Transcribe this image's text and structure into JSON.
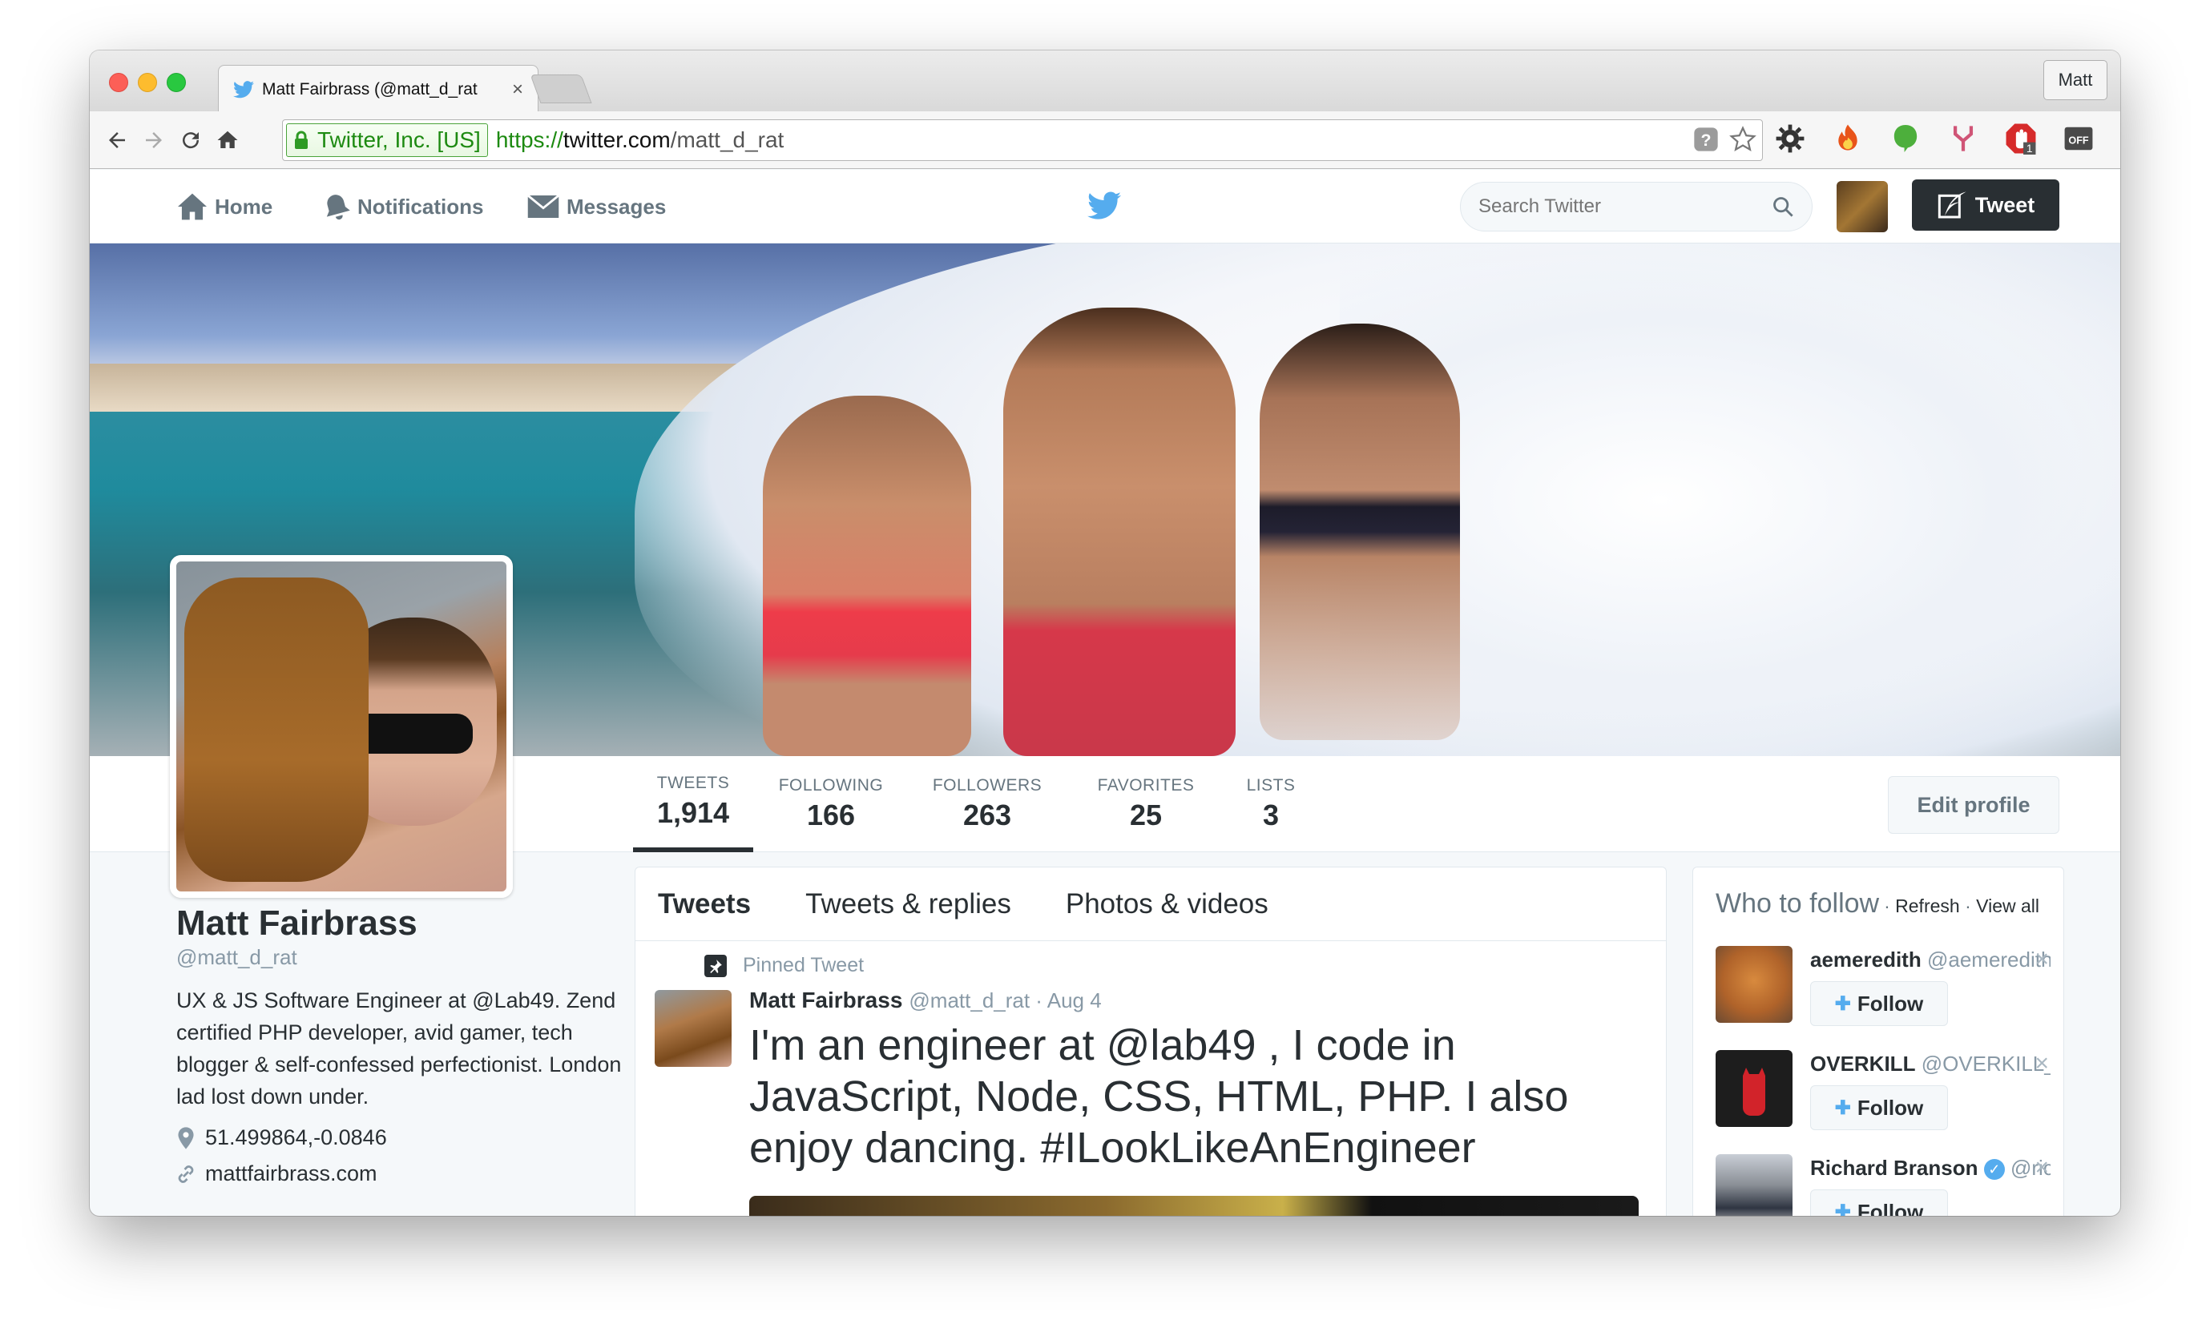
{
  "browser": {
    "tab_title": "Matt Fairbrass (@matt_d_rat",
    "tab_close": "×",
    "profile_button": "Matt",
    "ev_label": "Twitter, Inc. [US]",
    "url_scheme": "https://",
    "url_host": "twitter.com",
    "url_path": "/matt_d_rat"
  },
  "twitter_nav": {
    "home": "Home",
    "notifications": "Notifications",
    "messages": "Messages",
    "search_placeholder": "Search Twitter",
    "tweet_button": "Tweet"
  },
  "stats": [
    {
      "label": "TWEETS",
      "value": "1,914"
    },
    {
      "label": "FOLLOWING",
      "value": "166"
    },
    {
      "label": "FOLLOWERS",
      "value": "263"
    },
    {
      "label": "FAVORITES",
      "value": "25"
    },
    {
      "label": "LISTS",
      "value": "3"
    }
  ],
  "edit_profile": "Edit profile",
  "profile": {
    "name": "Matt Fairbrass",
    "handle": "@matt_d_rat",
    "bio_1": "UX & JS Software Engineer at ",
    "bio_link": "@Lab49",
    "bio_2": ". Zend certified PHP developer, avid gamer, tech blogger & self-confessed perfectionist. London lad lost down under.",
    "location": "51.499864,-0.0846",
    "website": "mattfairbrass.com"
  },
  "timeline": {
    "tabs": [
      "Tweets",
      "Tweets & replies",
      "Photos & videos"
    ],
    "pinned_label": "Pinned Tweet",
    "tweet_author": "Matt Fairbrass",
    "tweet_meta": "@matt_d_rat · Aug 4",
    "tweet_text": "I'm an engineer at @lab49 , I code in JavaScript, Node, CSS, HTML, PHP. I also enjoy dancing. #ILookLikeAnEngineer"
  },
  "who_to_follow": {
    "title": "Who to follow",
    "refresh": "Refresh",
    "view_all": "View all",
    "sep": "·",
    "follow_label": "Follow",
    "dismiss": "×",
    "suggestions": [
      {
        "name": "aemeredith",
        "handle": "@aemeredith"
      },
      {
        "name": "OVERKILL",
        "handle": "@OVERKILL_TM"
      },
      {
        "name": "Richard Branson",
        "handle": "@richa..."
      }
    ]
  },
  "colors": {
    "twitter_blue": "#55acee",
    "dark": "#292f33",
    "gray": "#66757f"
  }
}
